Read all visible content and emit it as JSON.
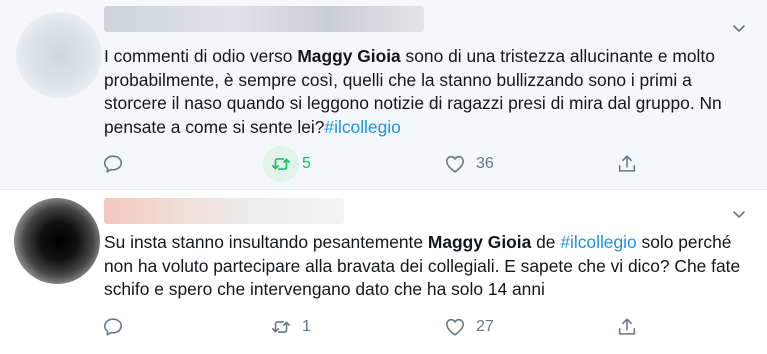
{
  "tweets": [
    {
      "text_parts": {
        "p1": "I commenti di odio verso ",
        "bold1": "Maggy Gioia",
        "p2": " sono di una tristezza allucinante e molto probabilmente, è sempre così, quelli che la stanno bullizzando sono i primi a storcere il naso quando si leggono notizie di ragazzi presi di mira dal gruppo. Nn pensate a come si sente lei?",
        "hashtag1": "#ilcollegio"
      },
      "actions": {
        "reply_count": "",
        "retweet_count": "5",
        "like_count": "36"
      },
      "retweeted": true
    },
    {
      "text_parts": {
        "p1": "Su insta stanno insultando pesantemente ",
        "bold1": "Maggy Gioia",
        "p2": " de ",
        "hashtag1": "#ilcollegio",
        "p3": " solo perché non ha voluto partecipare alla bravata dei collegiali. E sapete che vi dico? Che fate schifo e spero che intervengano dato che ha solo 14 anni"
      },
      "actions": {
        "reply_count": "",
        "retweet_count": "1",
        "like_count": "27"
      },
      "retweeted": false
    }
  ],
  "icons": {
    "reply": "reply-icon",
    "retweet": "retweet-icon",
    "like": "heart-icon",
    "share": "share-icon",
    "menu": "chevron-down-icon"
  },
  "colors": {
    "text": "#14171a",
    "muted": "#657786",
    "hashtag": "#1b95e0",
    "retweet_active": "#17bf63",
    "tweet_highlight_bg": "#f5f8fa"
  }
}
